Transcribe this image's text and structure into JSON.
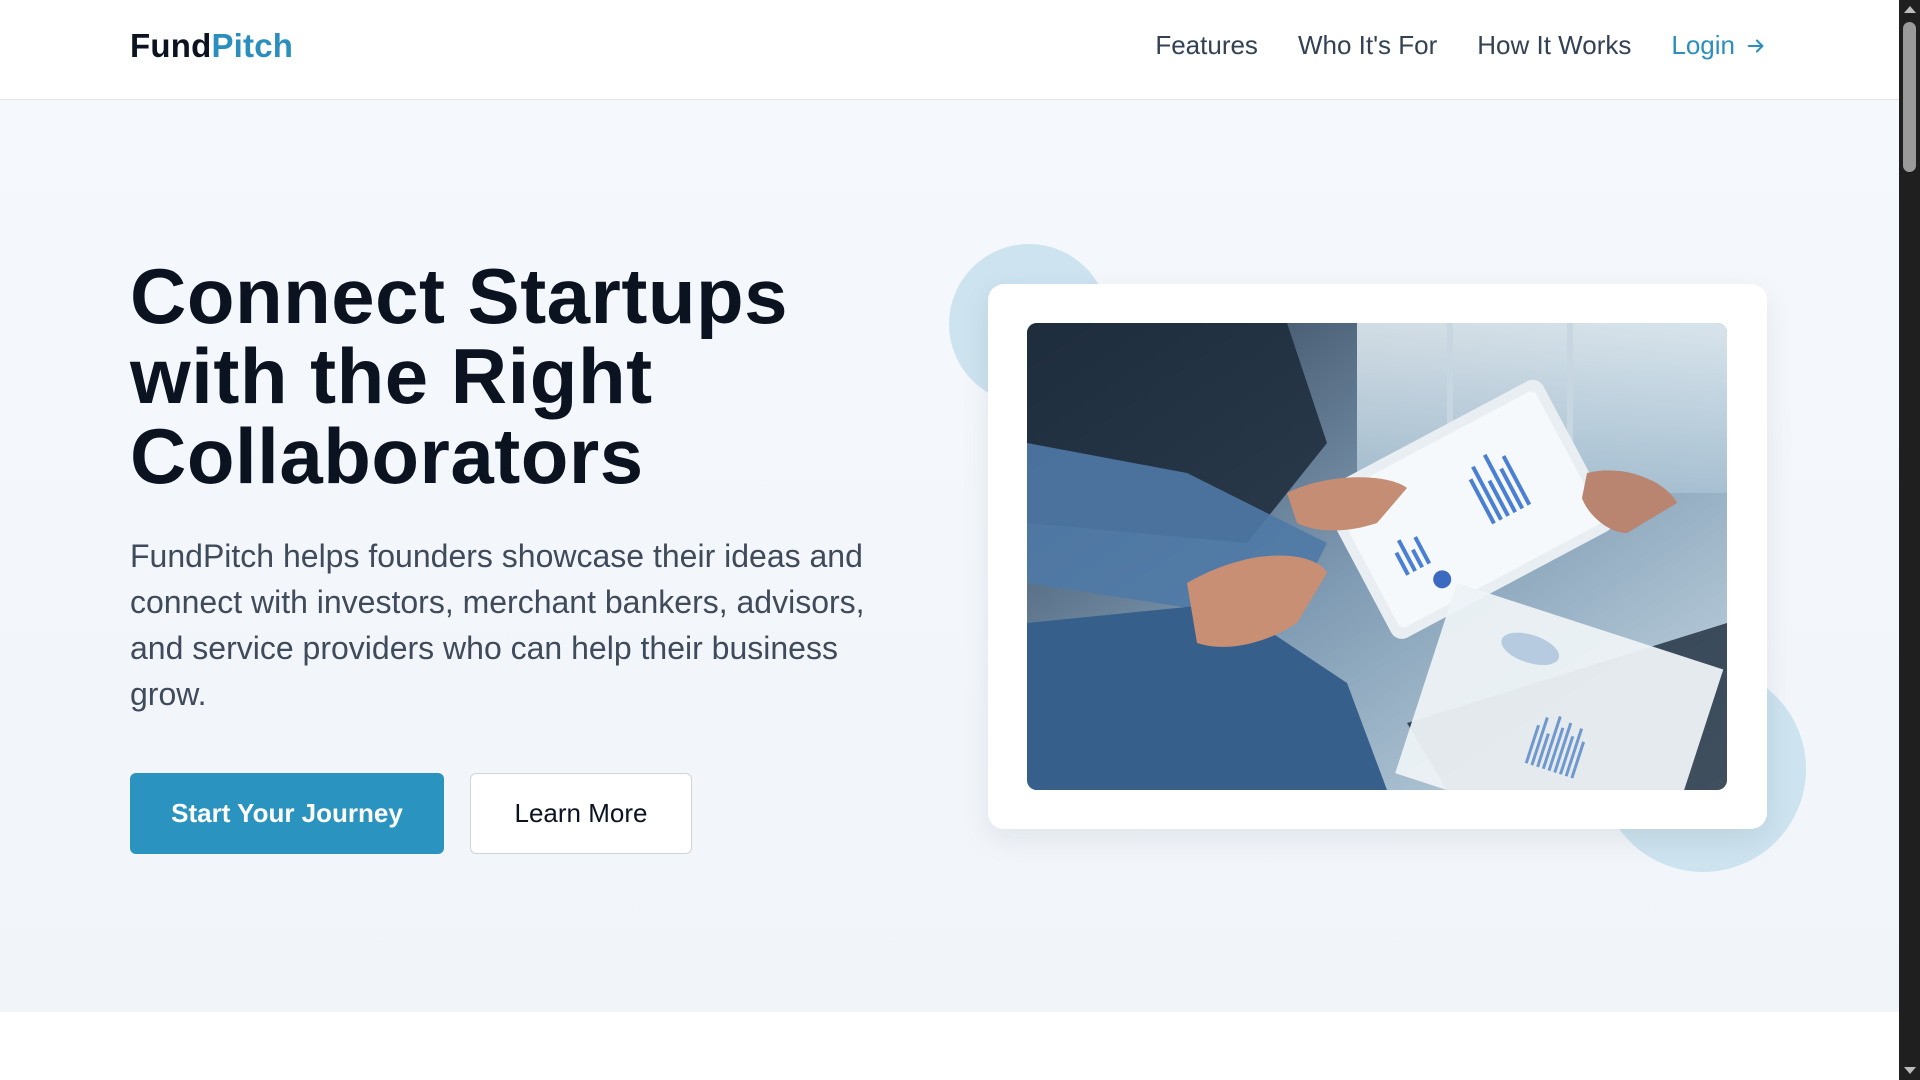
{
  "header": {
    "logo_part1": "Fund",
    "logo_part2": "Pitch",
    "nav": [
      {
        "label": "Features"
      },
      {
        "label": "Who It's For"
      },
      {
        "label": "How It Works"
      }
    ],
    "login_label": "Login"
  },
  "hero": {
    "title": "Connect Startups with the Right Collaborators",
    "description": "FundPitch helps founders showcase their ideas and connect with investors, merchant bankers, advisors, and service providers who can help their business grow.",
    "primary_button": "Start Your Journey",
    "secondary_button": "Learn More"
  },
  "colors": {
    "accent": "#2b8fbd",
    "primary_button": "#2a93c0",
    "hero_bg": "#f3f7fb",
    "circle": "#cde3ef"
  },
  "icons": {
    "login_arrow": "arrow-right-icon"
  }
}
